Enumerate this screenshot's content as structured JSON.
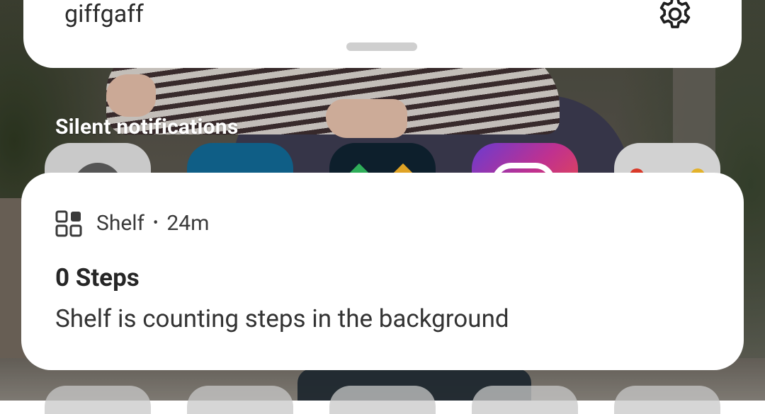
{
  "top_card": {
    "carrier": "giffgaff"
  },
  "silent_section": {
    "title": "Silent notifications",
    "app_icons": [
      "clock-app-icon",
      "blue-app-icon",
      "dark-app-icon",
      "instagram-app-icon",
      "maps-app-icon"
    ]
  },
  "notification": {
    "app_name": "Shelf",
    "separator": "•",
    "time": "24m",
    "title": "0 Steps",
    "body": "Shelf is counting steps in the background",
    "icon": "shelf-grid-icon"
  },
  "colors": {
    "card_background": "#ffffff",
    "section_title": "#ffffff",
    "handle": "#cfcfcf",
    "instagram_gradient_start": "#6a3bd0",
    "instagram_gradient_end": "#e5484f"
  }
}
